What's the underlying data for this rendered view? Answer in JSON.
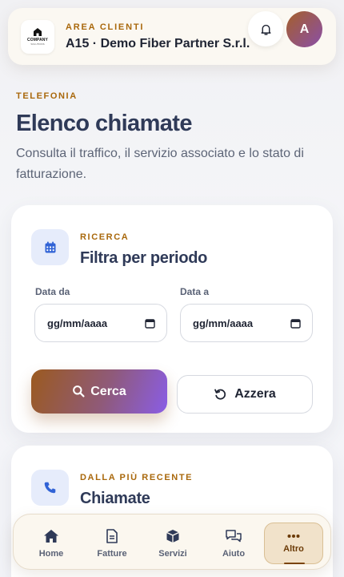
{
  "header": {
    "logo_text": "COMPANY",
    "logo_subtext": "SOLUTIONS",
    "eyebrow": "AREA CLIENTI",
    "company_name": "A15 · Demo Fiber Partner S.r.l.",
    "avatar_initial": "A"
  },
  "intro": {
    "eyebrow": "TELEFONIA",
    "title": "Elenco chiamate",
    "description": "Consulta il traffico, il servizio associato e lo stato di fatturazione."
  },
  "filter_card": {
    "eyebrow": "RICERCA",
    "title": "Filtra per periodo",
    "date_from_label": "Data da",
    "date_from_value": "gg/mm/aaaa",
    "date_to_label": "Data a",
    "date_to_value": "gg/mm/aaaa",
    "search_label": "Cerca",
    "reset_label": "Azzera"
  },
  "calls_card": {
    "eyebrow": "DALLA PIÙ RECENTE",
    "title": "Chiamate"
  },
  "bottom_nav": {
    "items": [
      {
        "label": "Home",
        "icon": "home-icon"
      },
      {
        "label": "Fatture",
        "icon": "invoice-icon"
      },
      {
        "label": "Servizi",
        "icon": "box-icon"
      },
      {
        "label": "Aiuto",
        "icon": "chat-icon"
      },
      {
        "label": "Altro",
        "icon": "more-icon",
        "active": true
      }
    ]
  },
  "colors": {
    "accent": "#a9680c",
    "heading": "#2f3a58",
    "icon_blue": "#3163d6"
  }
}
